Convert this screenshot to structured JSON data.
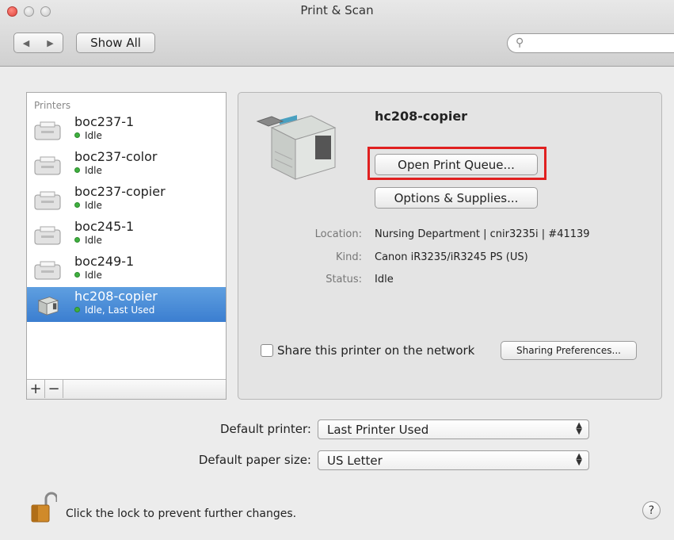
{
  "window": {
    "title": "Print & Scan"
  },
  "toolbar": {
    "back_icon": "◀",
    "forward_icon": "▶",
    "show_all_label": "Show All",
    "search_placeholder": ""
  },
  "printers": {
    "header": "Printers",
    "items": [
      {
        "name": "boc237-1",
        "status": "Idle",
        "selected": false
      },
      {
        "name": "boc237-color",
        "status": "Idle",
        "selected": false
      },
      {
        "name": "boc237-copier",
        "status": "Idle",
        "selected": false
      },
      {
        "name": "boc245-1",
        "status": "Idle",
        "selected": false
      },
      {
        "name": "boc249-1",
        "status": "Idle",
        "selected": false
      },
      {
        "name": "hc208-copier",
        "status": "Idle, Last Used",
        "selected": true
      }
    ],
    "add_label": "+",
    "remove_label": "−"
  },
  "detail": {
    "printer_name": "hc208-copier",
    "open_queue_label": "Open Print Queue...",
    "options_label": "Options & Supplies...",
    "location_label": "Location:",
    "location_value": "Nursing Department | cnir3235i | #41139",
    "kind_label": "Kind:",
    "kind_value": "Canon iR3235/iR3245 PS (US)",
    "status_label": "Status:",
    "status_value": "Idle",
    "share_label": "Share this printer on the network",
    "share_checked": false,
    "sharing_prefs_label": "Sharing Preferences..."
  },
  "defaults": {
    "printer_label": "Default printer:",
    "printer_value": "Last Printer Used",
    "paper_label": "Default paper size:",
    "paper_value": "US Letter"
  },
  "footer": {
    "lock_text": "Click the lock to prevent further changes.",
    "help_label": "?"
  },
  "colors": {
    "selection": "#3b7ed0",
    "highlight_box": "#e02020",
    "status_dot": "#3fb03f"
  }
}
